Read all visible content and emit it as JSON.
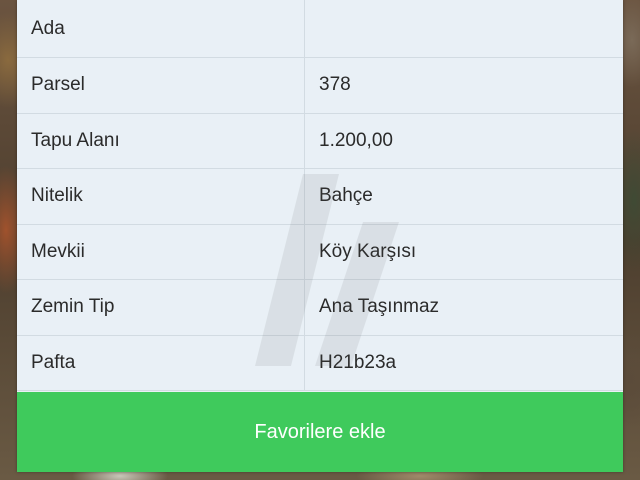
{
  "parcel_table": {
    "rows": [
      {
        "label": "Ada",
        "value": ""
      },
      {
        "label": "Parsel",
        "value": "378"
      },
      {
        "label": "Tapu Alanı",
        "value": "1.200,00"
      },
      {
        "label": "Nitelik",
        "value": "Bahçe"
      },
      {
        "label": "Mevkii",
        "value": "Köy Karşısı"
      },
      {
        "label": "Zemin Tip",
        "value": "Ana Taşınmaz"
      },
      {
        "label": "Pafta",
        "value": "H21b23a"
      }
    ]
  },
  "actions": {
    "favorite_label": "Favorilere ekle",
    "favorite_color": "#3fca5c"
  },
  "colors": {
    "panel_bg": "#eaf1f6",
    "divider": "#d2dbe2",
    "text": "#2b2b2b"
  }
}
